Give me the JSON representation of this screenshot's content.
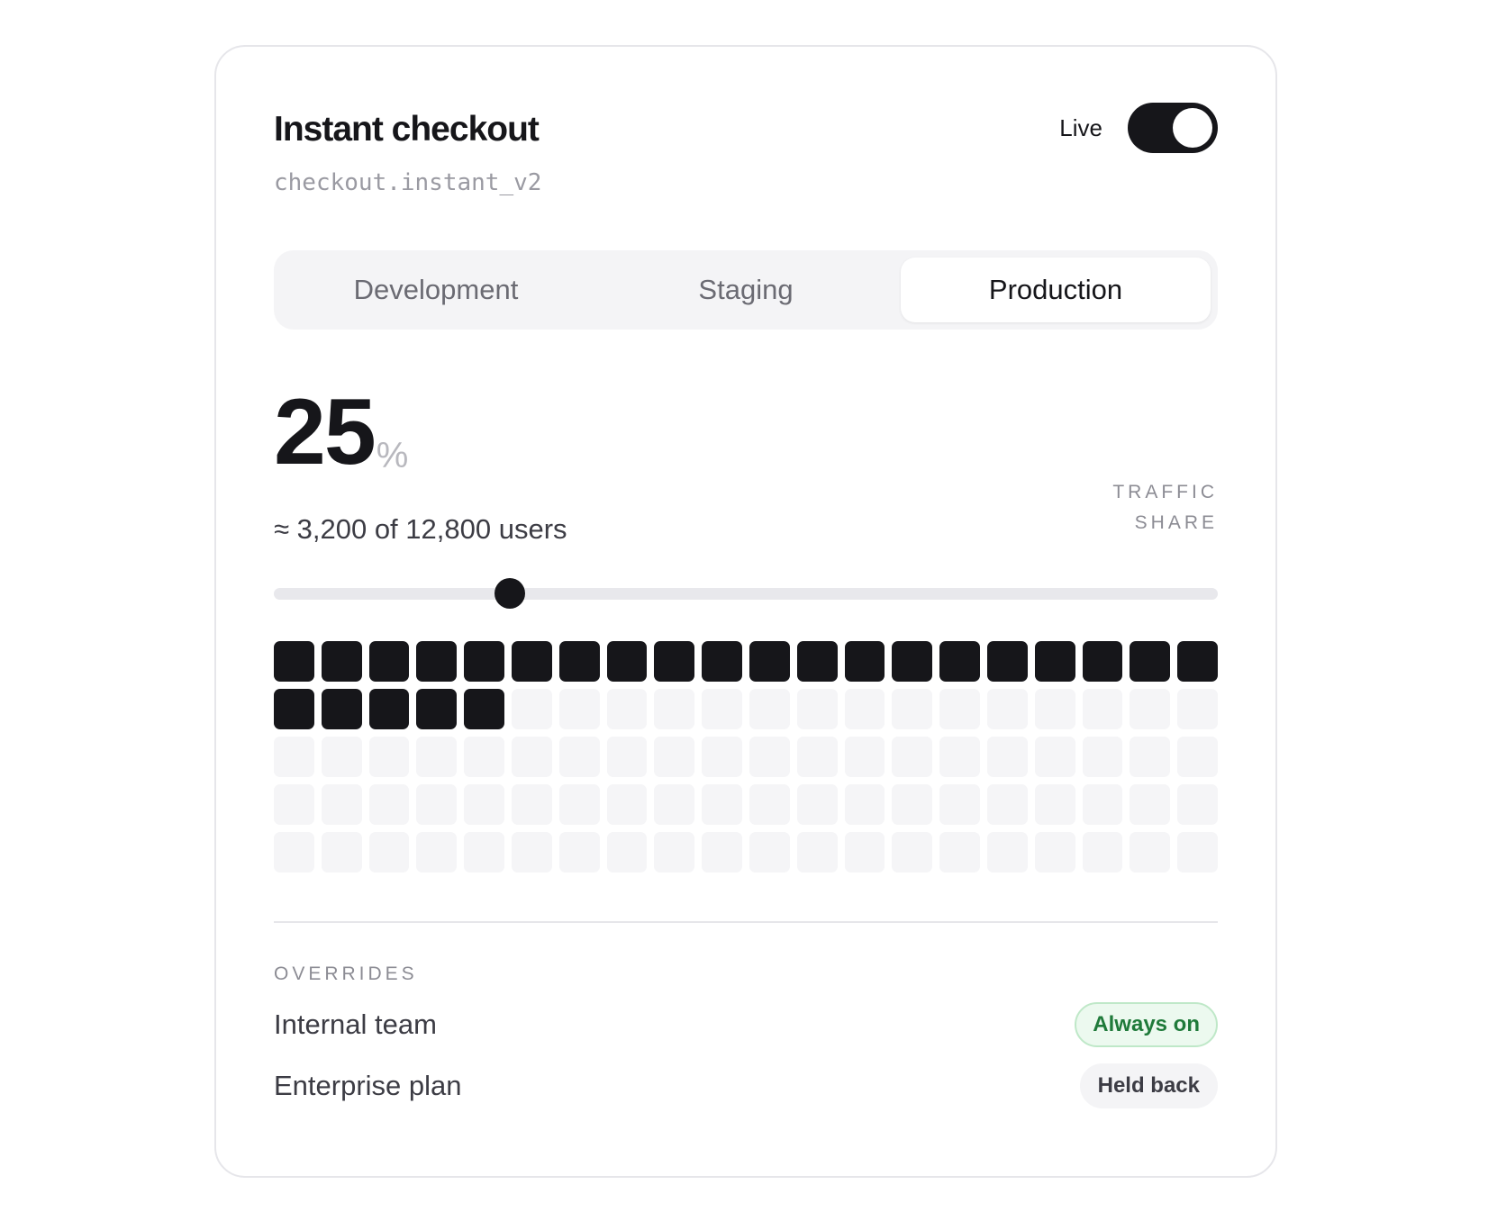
{
  "flag": {
    "title": "Instant checkout",
    "key": "checkout.instant_v2",
    "live_label": "Live",
    "live_enabled": true
  },
  "environments": {
    "tabs": [
      {
        "label": "Development",
        "active": false
      },
      {
        "label": "Staging",
        "active": false
      },
      {
        "label": "Production",
        "active": true
      }
    ]
  },
  "rollout": {
    "percent": "25",
    "unit": "%",
    "users_text": "≈ 3,200 of 12,800 users",
    "traffic_label_line1": "TRAFFIC",
    "traffic_label_line2": "SHARE",
    "slider_fraction": 0.25,
    "grid_total": 100,
    "grid_filled": 25
  },
  "overrides": {
    "title": "OVERRIDES",
    "items": [
      {
        "name": "Internal team",
        "badge": "Always on",
        "state": "on"
      },
      {
        "name": "Enterprise plan",
        "badge": "Held back",
        "state": "held"
      }
    ]
  },
  "colors": {
    "accent": "#16161a",
    "on_badge_text": "#1f7a3a",
    "on_badge_bg": "#ecf9ef"
  }
}
